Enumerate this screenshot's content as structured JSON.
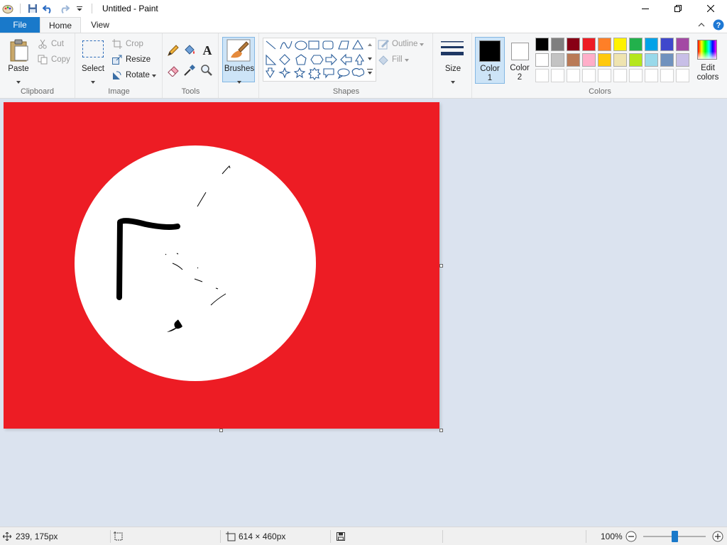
{
  "app": {
    "window_title": "Untitled - Paint"
  },
  "tabs": {
    "file": "File",
    "home": "Home",
    "view": "View"
  },
  "clipboard": {
    "paste": "Paste",
    "cut": "Cut",
    "copy": "Copy",
    "group": "Clipboard"
  },
  "image": {
    "select": "Select",
    "crop": "Crop",
    "resize": "Resize",
    "rotate": "Rotate",
    "group": "Image"
  },
  "tools": {
    "group": "Tools"
  },
  "brushes": {
    "label": "Brushes"
  },
  "shapes": {
    "outline": "Outline",
    "fill": "Fill",
    "group": "Shapes"
  },
  "size": {
    "label": "Size"
  },
  "colors": {
    "color1_line1": "Color",
    "color1_line2": "1",
    "color2_line1": "Color",
    "color2_line2": "2",
    "edit_line1": "Edit",
    "edit_line2": "colors",
    "group": "Colors",
    "color1_value": "#000000",
    "color2_value": "#ffffff",
    "palette_row1": [
      "#000000",
      "#7f7f7f",
      "#880015",
      "#ed1c24",
      "#ff7f27",
      "#fff200",
      "#22b14c",
      "#00a2e8",
      "#3f48cc",
      "#a349a4"
    ],
    "palette_row2": [
      "#ffffff",
      "#c3c3c3",
      "#b97a57",
      "#ffaec9",
      "#ffc90e",
      "#efe4b0",
      "#b5e61d",
      "#99d9ea",
      "#7092be",
      "#c8bfe7"
    ]
  },
  "canvas": {
    "background": "#ed1c24",
    "circle_color": "#ffffff"
  },
  "status": {
    "cursor_position": "239, 175px",
    "image_size": "614 × 460px",
    "zoom": "100%"
  }
}
